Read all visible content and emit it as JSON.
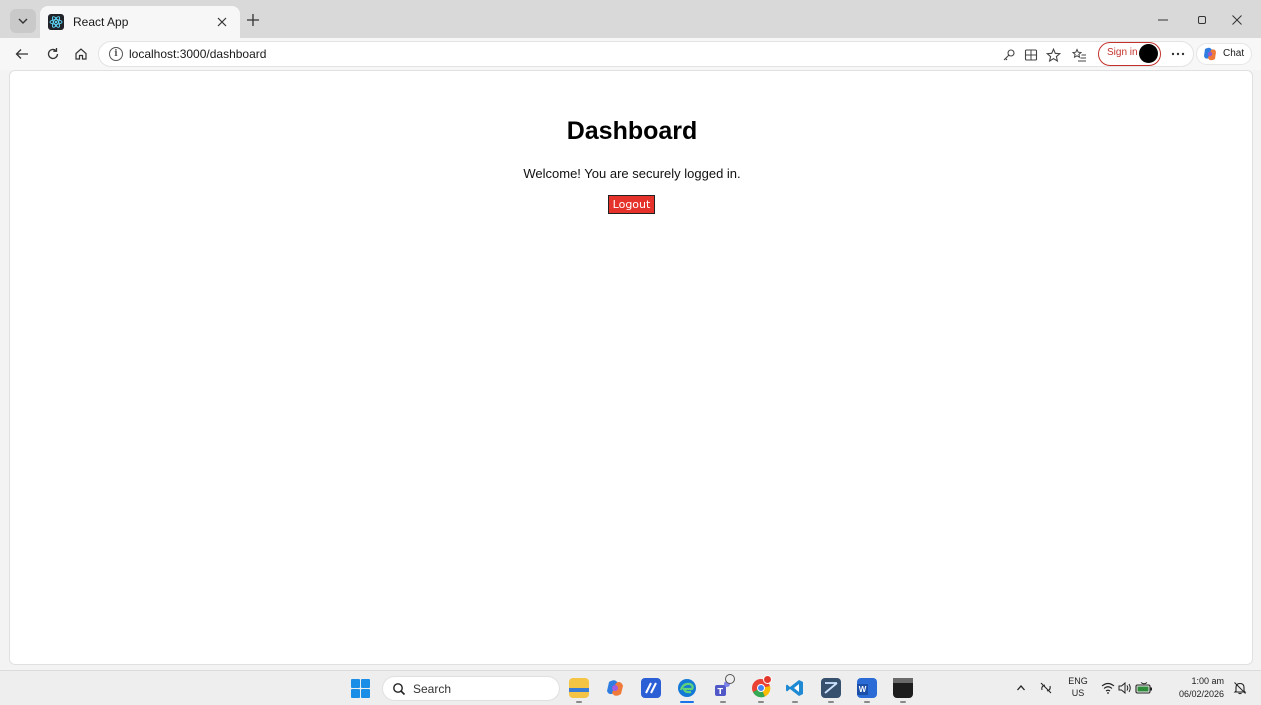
{
  "browser": {
    "tab": {
      "title": "React App",
      "favicon": "react-icon"
    },
    "address": {
      "url": "localhost:3000/dashboard"
    },
    "signin_label": "Sign in",
    "chat_label": "Chat"
  },
  "page": {
    "title": "Dashboard",
    "welcome": "Welcome! You are securely logged in.",
    "logout_label": "Logout"
  },
  "taskbar": {
    "search_placeholder": "Search",
    "apps": [
      "file-explorer",
      "copilot",
      "app-tile",
      "edge",
      "teams",
      "chrome",
      "vscode",
      "app-window",
      "word",
      "terminal"
    ]
  },
  "tray": {
    "lang_line1": "ENG",
    "lang_line2": "US",
    "time": "1:00 am",
    "date": "06/02/2026"
  },
  "colors": {
    "logout_bg": "#e5322a",
    "signin_border": "#c4312b",
    "windows_blue": "#1a8ee6"
  }
}
